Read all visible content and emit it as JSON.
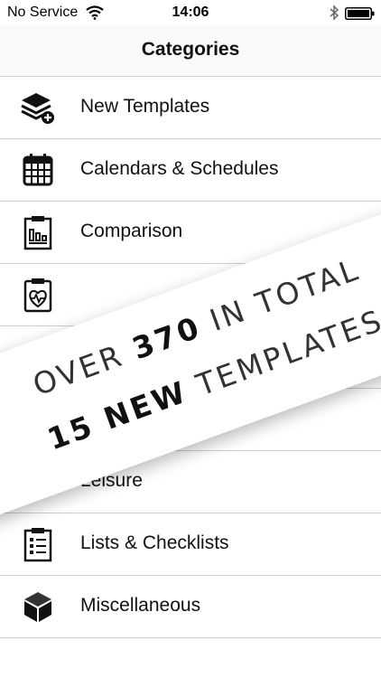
{
  "status_bar": {
    "carrier": "No Service",
    "time": "14:06"
  },
  "nav": {
    "title": "Categories"
  },
  "categories": [
    {
      "label": "New Templates",
      "icon": "layers-add-icon"
    },
    {
      "label": "Calendars & Schedules",
      "icon": "calendar-icon"
    },
    {
      "label": "Comparison",
      "icon": "comparison-clipboard-icon"
    },
    {
      "label": "",
      "icon": "health-clipboard-icon"
    },
    {
      "label": "",
      "icon": ""
    },
    {
      "label": "",
      "icon": ""
    },
    {
      "label": "Leisure",
      "icon": "leisure-icon"
    },
    {
      "label": "Lists & Checklists",
      "icon": "checklist-icon"
    },
    {
      "label": "Miscellaneous",
      "icon": "cube-icon"
    }
  ],
  "banner": {
    "line1_a": "OVER ",
    "line1_num": "370",
    "line1_b": " IN TOTAL",
    "line2_num": "15 NEW",
    "line2_b": " TEMPLATES"
  },
  "colors": {
    "separator": "#cfcfcf",
    "text": "#111111",
    "background": "#ffffff"
  }
}
